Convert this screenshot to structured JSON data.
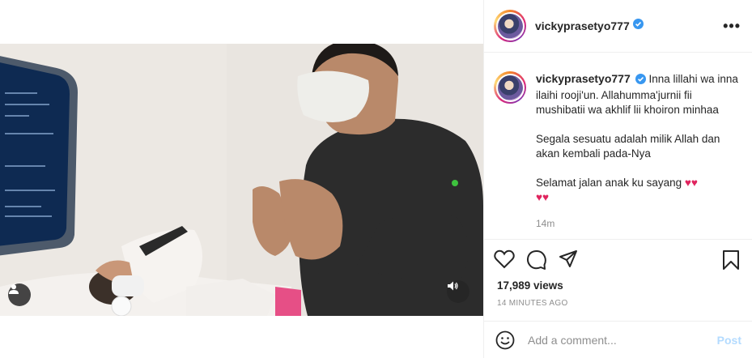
{
  "post": {
    "username": "vickyprasetyo777",
    "verified": true,
    "more_icon": "more-options-icon",
    "caption": {
      "line1": "Inna lillahi wa inna ilaihi rooji'un. Allahumma'jurnii fii mushibatii wa akhlif lii khoiron minhaa",
      "line2": "Segala sesuatu adalah milik Allah dan akan kembali pada-Nya",
      "line3": "Selamat jalan anak ku sayang",
      "hearts_inline": "♥♥",
      "hearts_next": "♥♥"
    },
    "time_ago": "14m",
    "views": "17,989 views",
    "timestamp": "14 MINUTES AGO"
  },
  "video": {
    "tag_user_icon": "user-tag-icon",
    "sound_icon": "speaker-icon"
  },
  "actions": {
    "like_icon": "heart-icon",
    "comment_icon": "comment-icon",
    "share_icon": "share-icon",
    "save_icon": "bookmark-icon"
  },
  "comment": {
    "placeholder": "Add a comment...",
    "post_label": "Post",
    "emoji_icon": "emoji-icon"
  },
  "colors": {
    "verified_blue": "#3897f0",
    "post_disabled": "#b3dbff",
    "heart_red": "#e0245e",
    "muted": "#8e8e8e"
  }
}
